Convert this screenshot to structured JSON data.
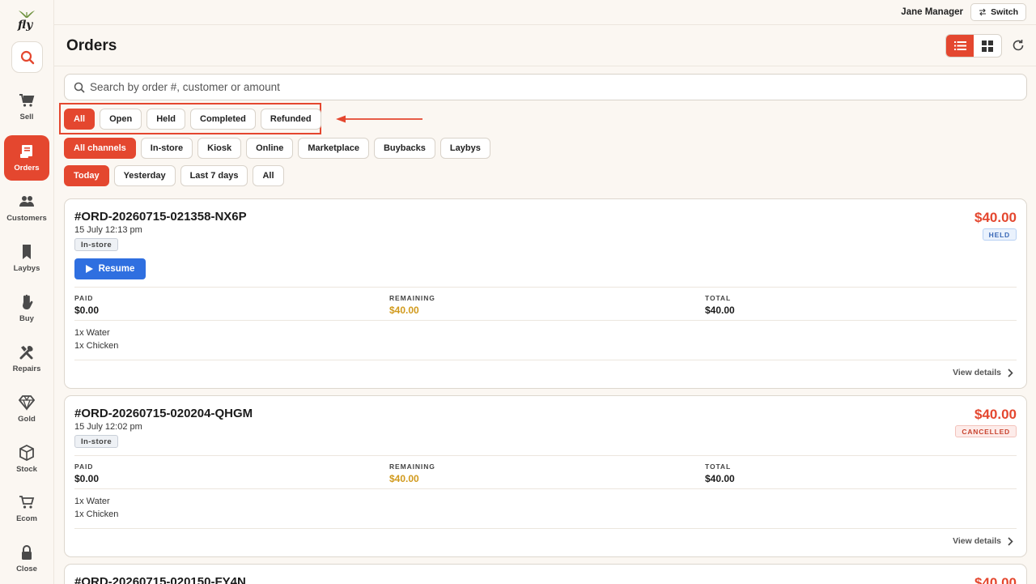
{
  "app": {
    "logo_text": "fly"
  },
  "topbar": {
    "user": "Jane Manager",
    "switch_label": "Switch"
  },
  "sidebar": {
    "items": [
      {
        "label": "Sell",
        "icon": "cart-icon"
      },
      {
        "label": "Orders",
        "icon": "receipt-icon",
        "active": true
      },
      {
        "label": "Customers",
        "icon": "users-icon"
      },
      {
        "label": "Laybys",
        "icon": "bookmark-icon"
      },
      {
        "label": "Buy",
        "icon": "hand-icon"
      },
      {
        "label": "Repairs",
        "icon": "tools-icon"
      },
      {
        "label": "Gold",
        "icon": "diamond-icon"
      },
      {
        "label": "Stock",
        "icon": "box-icon"
      },
      {
        "label": "Ecom",
        "icon": "shopping-cart-icon"
      },
      {
        "label": "Close",
        "icon": "lock-icon"
      }
    ]
  },
  "page": {
    "title": "Orders"
  },
  "search": {
    "placeholder": "Search by order #, customer or amount"
  },
  "filters": {
    "status": [
      "All",
      "Open",
      "Held",
      "Completed",
      "Refunded"
    ],
    "channels": [
      "All channels",
      "In-store",
      "Kiosk",
      "Online",
      "Marketplace",
      "Buybacks",
      "Laybys"
    ],
    "dates": [
      "Today",
      "Yesterday",
      "Last 7 days",
      "All"
    ]
  },
  "orders": [
    {
      "id": "#ORD-20260715-021358-NX6P",
      "date": "15 July 12:13 pm",
      "channel": "In-store",
      "amount": "$40.00",
      "status": "HELD",
      "resume_label": "Resume",
      "paid_label": "PAID",
      "paid": "$0.00",
      "remaining_label": "REMAINING",
      "remaining": "$40.00",
      "total_label": "TOTAL",
      "total": "$40.00",
      "items": [
        "1x Water",
        "1x Chicken"
      ],
      "view_details": "View details"
    },
    {
      "id": "#ORD-20260715-020204-QHGM",
      "date": "15 July 12:02 pm",
      "channel": "In-store",
      "amount": "$40.00",
      "status": "CANCELLED",
      "paid_label": "PAID",
      "paid": "$0.00",
      "remaining_label": "REMAINING",
      "remaining": "$40.00",
      "total_label": "TOTAL",
      "total": "$40.00",
      "items": [
        "1x Water",
        "1x Chicken"
      ],
      "view_details": "View details"
    },
    {
      "id": "#ORD-20260715-020150-FY4N",
      "amount": "$40.00"
    }
  ],
  "colors": {
    "accent": "#e4472f",
    "resume": "#2f6fe0",
    "remaining": "#d19a1d"
  }
}
